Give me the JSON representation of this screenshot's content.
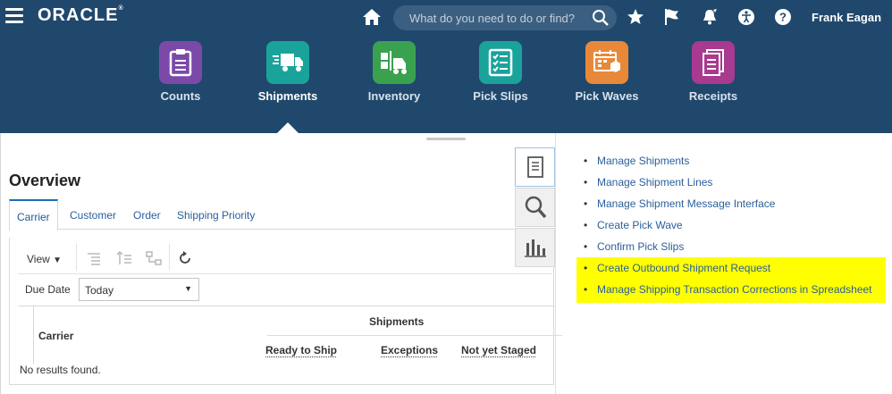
{
  "header": {
    "logo": "ORACLE",
    "logo_mark": "®",
    "search_placeholder": "What do you need to do or find?",
    "user_name": "Frank Eagan"
  },
  "apps": [
    {
      "label": "Counts",
      "color": "#7b4aa8",
      "icon": "clipboard-icon"
    },
    {
      "label": "Shipments",
      "color": "#1aa39a",
      "icon": "truck-icon",
      "active": true
    },
    {
      "label": "Inventory",
      "color": "#3aa24f",
      "icon": "forklift-icon"
    },
    {
      "label": "Pick Slips",
      "color": "#1aa39a",
      "icon": "checklist-icon"
    },
    {
      "label": "Pick Waves",
      "color": "#e8893a",
      "icon": "calendar-boxes-icon"
    },
    {
      "label": "Receipts",
      "color": "#a83a8f",
      "icon": "documents-icon"
    }
  ],
  "overview": {
    "title": "Overview",
    "tabs": [
      "Carrier",
      "Customer",
      "Order",
      "Shipping Priority"
    ],
    "active_tab": "Carrier",
    "toolbar": {
      "view_label": "View"
    },
    "due_date": {
      "label": "Due Date",
      "value": "Today"
    },
    "table": {
      "group_header": "Shipments",
      "columns": [
        "Carrier",
        "Ready to Ship",
        "Exceptions",
        "Not yet Staged"
      ],
      "empty_text": "No results found."
    }
  },
  "tasks": {
    "links": [
      "Manage Shipments",
      "Manage Shipment Lines",
      "Manage Shipment Message Interface",
      "Create Pick Wave",
      "Confirm Pick Slips",
      "Create Outbound Shipment Request",
      "Manage Shipping Transaction Corrections in Spreadsheet"
    ],
    "highlighted": [
      "Create Outbound Shipment Request",
      "Manage Shipping Transaction Corrections in Spreadsheet"
    ]
  },
  "colors": {
    "header_bg": "#20486d",
    "link": "#2a5f9a",
    "highlight": "#ffff00"
  }
}
